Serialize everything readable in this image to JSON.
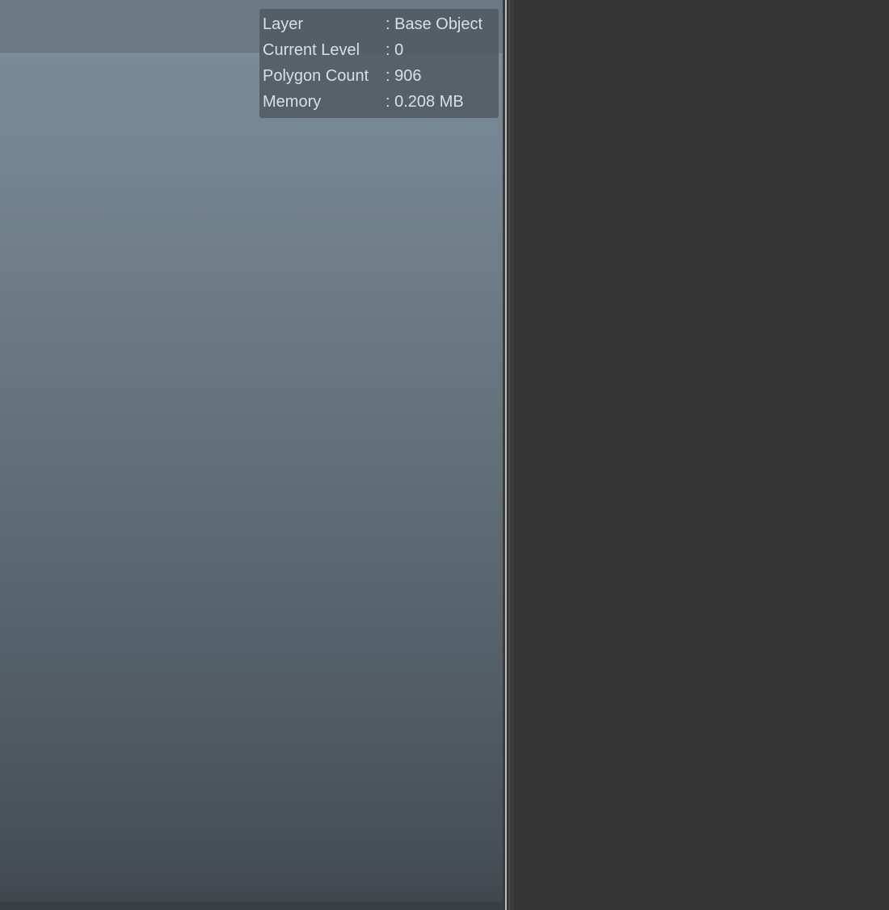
{
  "info_overlay": {
    "rows": [
      {
        "label": "Layer",
        "value": ": Base Object"
      },
      {
        "label": "Current Level",
        "value": ": 0"
      },
      {
        "label": "Polygon Count",
        "value": ": 906"
      },
      {
        "label": "Memory",
        "value": ": 0.208 MB"
      }
    ]
  },
  "colors": {
    "viewport_top": "#7d8e9b",
    "viewport_bottom": "#3f464c",
    "panel_background": "#353535",
    "hud_text": "#dcdfe2"
  }
}
